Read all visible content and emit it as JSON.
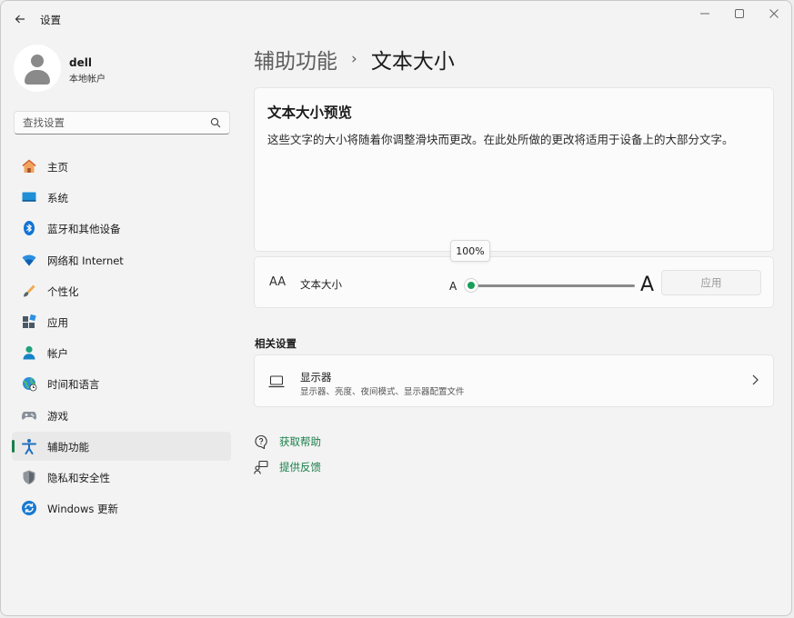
{
  "window": {
    "title": "设置",
    "controls": {
      "minimize": "—",
      "maximize": "☐",
      "close": "✕"
    }
  },
  "user": {
    "name": "dell",
    "account_type": "本地帐户"
  },
  "search": {
    "placeholder": "查找设置"
  },
  "sidebar": {
    "items": [
      {
        "label": "主页",
        "icon": "home-icon"
      },
      {
        "label": "系统",
        "icon": "system-icon"
      },
      {
        "label": "蓝牙和其他设备",
        "icon": "bluetooth-icon"
      },
      {
        "label": "网络和 Internet",
        "icon": "network-icon"
      },
      {
        "label": "个性化",
        "icon": "personalization-icon"
      },
      {
        "label": "应用",
        "icon": "apps-icon"
      },
      {
        "label": "帐户",
        "icon": "accounts-icon"
      },
      {
        "label": "时间和语言",
        "icon": "time-language-icon"
      },
      {
        "label": "游戏",
        "icon": "gaming-icon"
      },
      {
        "label": "辅助功能",
        "icon": "accessibility-icon",
        "active": true
      },
      {
        "label": "隐私和安全性",
        "icon": "privacy-shield-icon"
      },
      {
        "label": "Windows 更新",
        "icon": "windows-update-icon"
      }
    ]
  },
  "breadcrumb": {
    "parent": "辅助功能",
    "separator": "›",
    "current": "文本大小"
  },
  "preview": {
    "title": "文本大小预览",
    "text": "这些文字的大小将随着你调整滑块而更改。在此处所做的更改将适用于设备上的大部分文字。"
  },
  "text_size": {
    "label": "文本大小",
    "icon_text": "AA",
    "small_marker": "A",
    "large_marker": "A",
    "slider_value_percent": 100,
    "tooltip": "100%",
    "apply_label": "应用"
  },
  "related": {
    "section_title": "相关设置",
    "display": {
      "title": "显示器",
      "subtitle": "显示器、亮度、夜间模式、显示器配置文件"
    }
  },
  "links": {
    "help": "获取帮助",
    "feedback": "提供反馈"
  },
  "colors": {
    "accent": "#1a7f4b",
    "slider_thumb": "#1a9f5b"
  }
}
